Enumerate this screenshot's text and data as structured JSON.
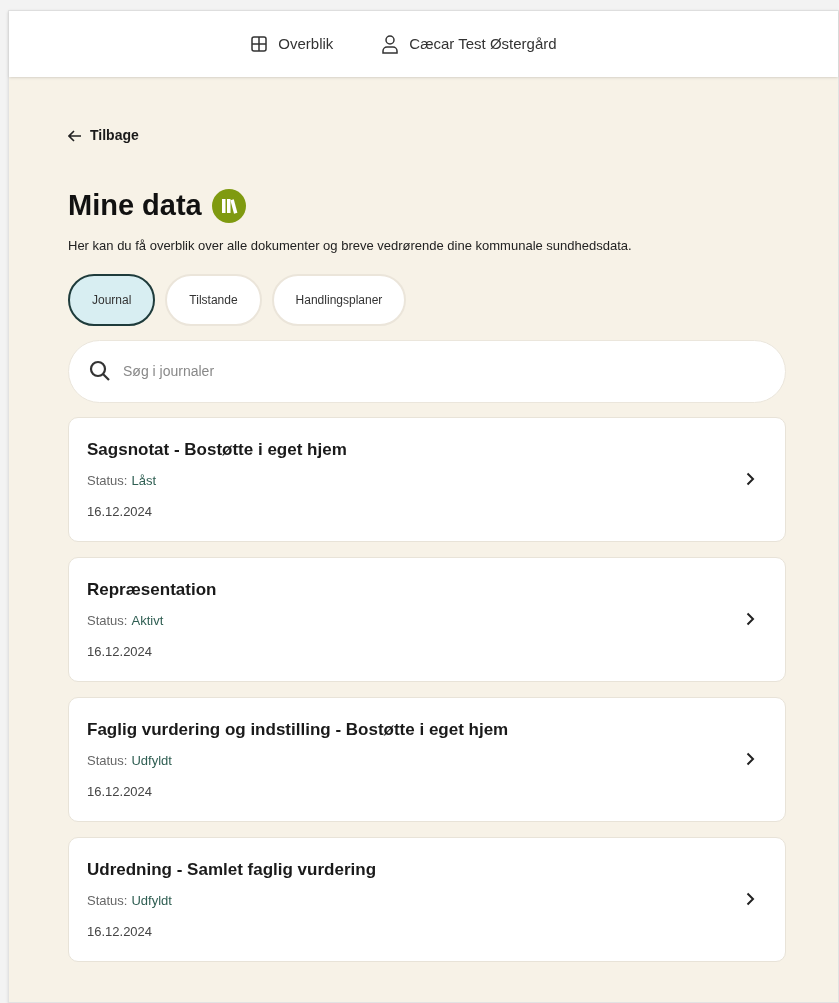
{
  "nav": [
    {
      "kind": "grid",
      "label": "Overblik"
    },
    {
      "kind": "person",
      "label": "Cæcar Test Østergård"
    }
  ],
  "back": {
    "label": "Tilbage"
  },
  "title": "Mine data",
  "description": "Her kan du få overblik over alle dokumenter og breve vedrørende dine kommunale sundhedsdata.",
  "tabs": [
    {
      "label": "Journal",
      "selected": true
    },
    {
      "label": "Tilstande",
      "selected": false
    },
    {
      "label": "Handlingsplaner",
      "selected": false
    }
  ],
  "search": {
    "placeholder": "Søg i journaler"
  },
  "items": [
    {
      "title": "Sagsnotat - Bostøtte i eget hjem",
      "status_label": "Status:",
      "status": "Låst",
      "date": "16.12.2024"
    },
    {
      "title": "Repræsentation",
      "status_label": "Status:",
      "status": "Aktivt",
      "date": "16.12.2024"
    },
    {
      "title": "Faglig vurdering og indstilling - Bostøtte i eget hjem",
      "status_label": "Status:",
      "status": "Udfyldt",
      "date": "16.12.2024"
    },
    {
      "title": "Udredning - Samlet faglig vurdering",
      "status_label": "Status:",
      "status": "Udfyldt",
      "date": "16.12.2024"
    }
  ]
}
